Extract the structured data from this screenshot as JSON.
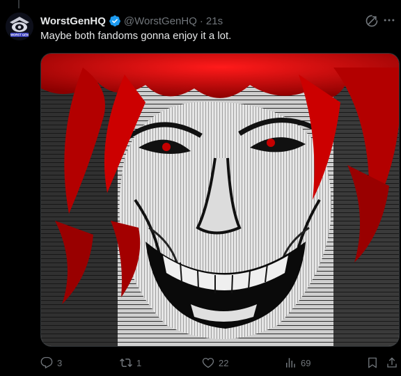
{
  "tweet": {
    "author_name": "WorstGenHQ",
    "author_handle": "@WorstGenHQ",
    "separator": "·",
    "time": "21s",
    "text": "Maybe both fandoms gonna enjoy it a lot.",
    "verified": true,
    "avatar_label": "WORST GEN",
    "media_description_icon": "manga-illustration",
    "accent_color": "#1d9bf0"
  },
  "actions": {
    "replies": "3",
    "reposts": "1",
    "likes": "22",
    "views": "69"
  }
}
